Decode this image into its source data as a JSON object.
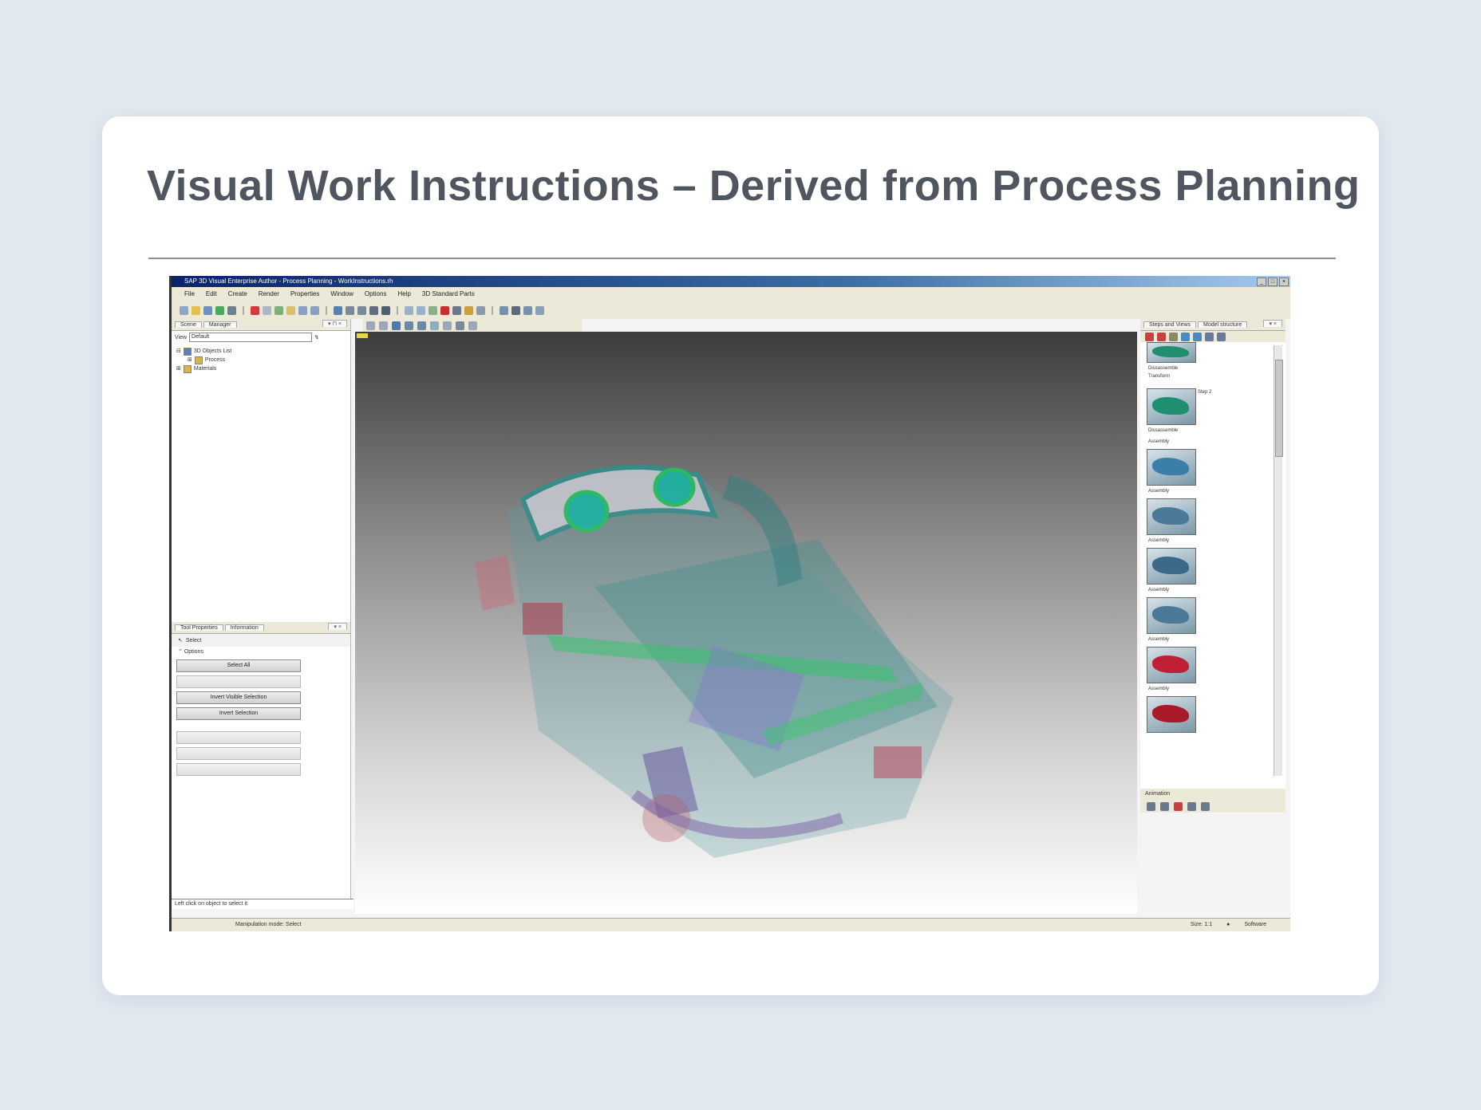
{
  "slide": {
    "title": "Visual Work Instructions – Derived from Process Planning"
  },
  "app": {
    "window_title": "SAP 3D Visual Enterprise Author - Process Planning - WorkInstructions.rh",
    "window_controls": [
      "_",
      "□",
      "×"
    ],
    "menu": [
      "File",
      "Edit",
      "Create",
      "Render",
      "Properties",
      "Window",
      "Options",
      "Help",
      "3D Standard Parts"
    ],
    "left_panel": {
      "tabs": [
        "Scene",
        "Manager"
      ],
      "view_label": "View",
      "view_value": "Default",
      "tree": [
        "3D Objects List",
        "Process",
        "Materials"
      ],
      "lower_tabs": [
        "Tool Properties",
        "Information"
      ],
      "select_label": "Select",
      "options_label": "Options",
      "buttons": [
        "Select All",
        "",
        "Invert Visible Selection",
        "Invert Selection"
      ],
      "disabled_buttons": [
        "",
        "",
        ""
      ],
      "status": "Left click on object to select it"
    },
    "right_panel": {
      "tabs": [
        "Steps and Views",
        "Model structure"
      ],
      "items": [
        {
          "label": "Dissassemble",
          "sub": "Transform"
        },
        {
          "label": "Step 2",
          "sub": "Dissassemble"
        },
        {
          "label": "Assembly"
        },
        {
          "label": "Assembly"
        },
        {
          "label": "Assembly"
        },
        {
          "label": "Assembly"
        },
        {
          "label": "Assembly"
        },
        {
          "label": "Assembly"
        }
      ],
      "footer": "Animation"
    },
    "statusbar": {
      "left": "Manipulation mode: Select",
      "zoom": "Size: 1:1",
      "mode": "Software"
    }
  },
  "colors": {
    "page_bg": "#e3e9f1",
    "title_text": "#505660",
    "viewport_top": "#3c3c3c",
    "car_teal": "#2f8f8c",
    "car_green": "#22c55e",
    "car_red": "#b03045"
  }
}
